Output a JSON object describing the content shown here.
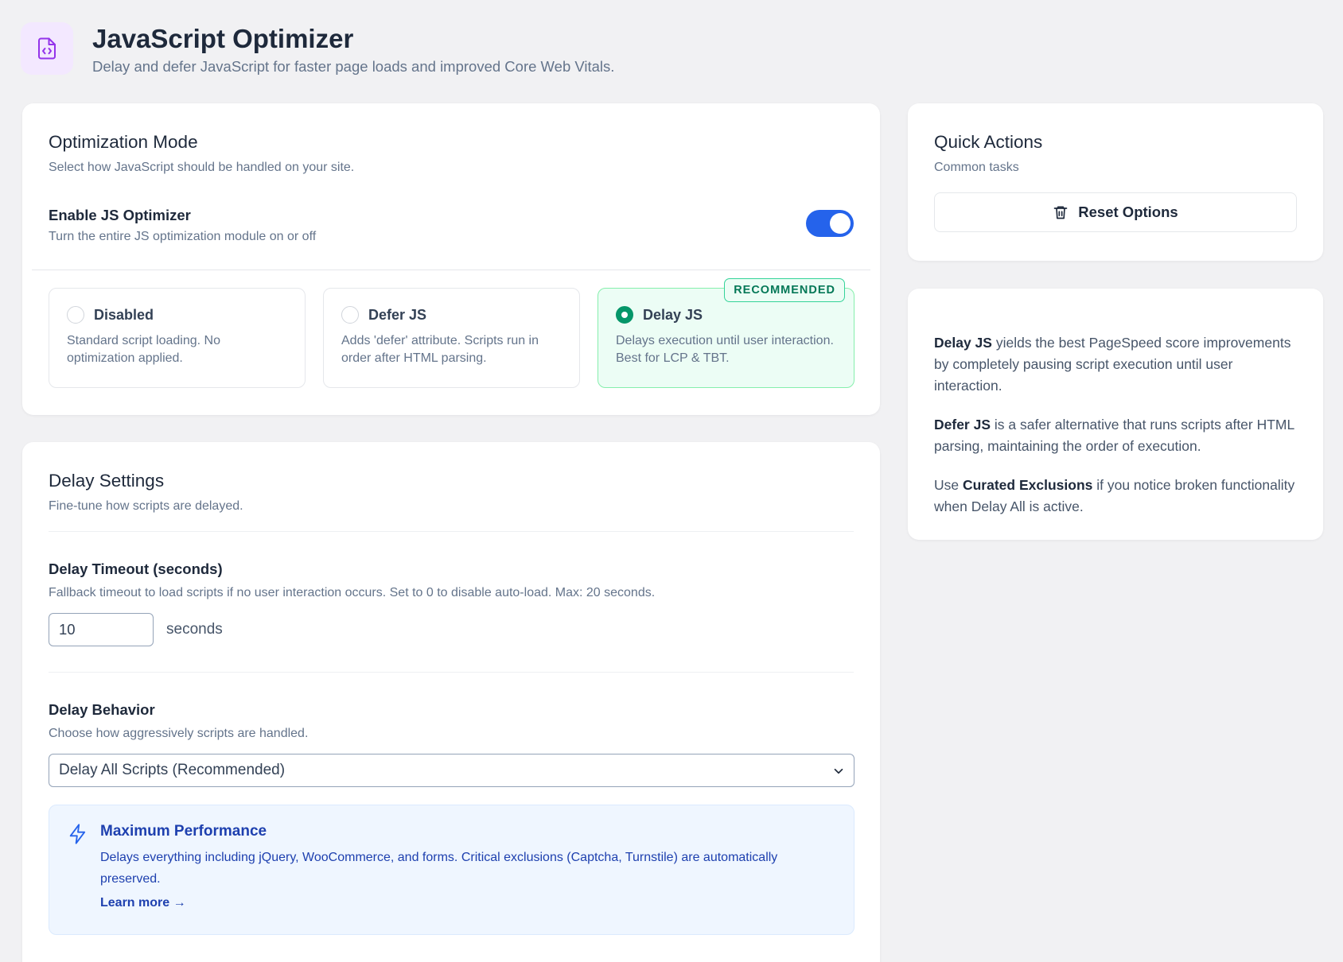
{
  "header": {
    "title": "JavaScript Optimizer",
    "subtitle": "Delay and defer JavaScript for faster page loads and improved Core Web Vitals.",
    "icon": "file-code-icon"
  },
  "mode": {
    "title": "Optimization Mode",
    "desc": "Select how JavaScript should be handled on your site.",
    "toggle": {
      "label": "Enable JS Optimizer",
      "desc": "Turn the entire JS optimization module on or off",
      "enabled": true
    },
    "options": [
      {
        "title": "Disabled",
        "desc": "Standard script loading. No optimization applied.",
        "selected": false
      },
      {
        "title": "Defer JS",
        "desc": "Adds 'defer' attribute. Scripts run in order after HTML parsing.",
        "selected": false
      },
      {
        "title": "Delay JS",
        "desc": "Delays execution until user interaction. Best for LCP & TBT.",
        "selected": true,
        "badge": "RECOMMENDED"
      }
    ]
  },
  "delay": {
    "title": "Delay Settings",
    "desc": "Fine-tune how scripts are delayed.",
    "timeout": {
      "label": "Delay Timeout (seconds)",
      "desc": "Fallback timeout to load scripts if no user interaction occurs. Set to 0 to disable auto-load. Max: 20 seconds.",
      "value": "10",
      "unit": "seconds"
    },
    "behavior": {
      "label": "Delay Behavior",
      "desc": "Choose how aggressively scripts are handled.",
      "selected": "Delay All Scripts (Recommended)"
    },
    "info": {
      "title": "Maximum Performance",
      "desc": "Delays everything including jQuery, WooCommerce, and forms. Critical exclusions (Captcha, Turnstile) are automatically preserved.",
      "link": "Learn more →"
    }
  },
  "quick_actions": {
    "title": "Quick Actions",
    "desc": "Common tasks",
    "reset_label": "Reset Options"
  },
  "tips": [
    {
      "bold": "Delay JS",
      "text": " yields the best PageSpeed score improvements by completely pausing script execution until user interaction."
    },
    {
      "bold": "Defer JS",
      "text": " is a safer alternative that runs scripts after HTML parsing, maintaining the order of execution."
    },
    {
      "pre": "Use ",
      "bold": "Curated Exclusions",
      "text": " if you notice broken functionality when Delay All is active."
    }
  ],
  "colors": {
    "accent": "#2563eb",
    "success": "#059669",
    "info": "#1e40af",
    "icon_bg": "#f3e8ff",
    "icon": "#9333ea"
  }
}
